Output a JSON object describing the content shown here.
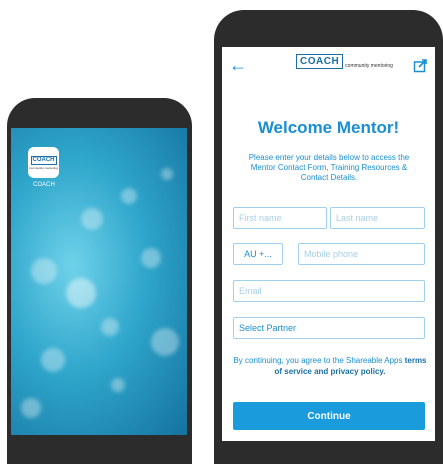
{
  "home_screen": {
    "app_icon": {
      "logo_text": "COACH",
      "logo_subtext": "community mentoring"
    },
    "app_label": "COACH"
  },
  "form_screen": {
    "logo": {
      "text": "COACH",
      "subtext": "community mentoring"
    },
    "back_icon": "arrow-left-icon",
    "share_icon": "share-icon",
    "title": "Welcome Mentor!",
    "intro": "Please enter your details below to access the Mentor Contact Form, Training Resources & Contact Details.",
    "fields": {
      "first_name_placeholder": "First name",
      "last_name_placeholder": "Last name",
      "country_code": "AU +...",
      "mobile_placeholder": "Mobile phone",
      "email_placeholder": "Email",
      "partner_select": "Select Partner"
    },
    "terms": {
      "prefix": "By continuing, you agree to the Shareable Apps",
      "link": "terms of service and privacy policy."
    },
    "continue_label": "Continue"
  },
  "colors": {
    "accent": "#1a8fd1",
    "button": "#1a9bdc",
    "phone_frame": "#2c2c2c",
    "field_border": "#9fd0ee"
  }
}
